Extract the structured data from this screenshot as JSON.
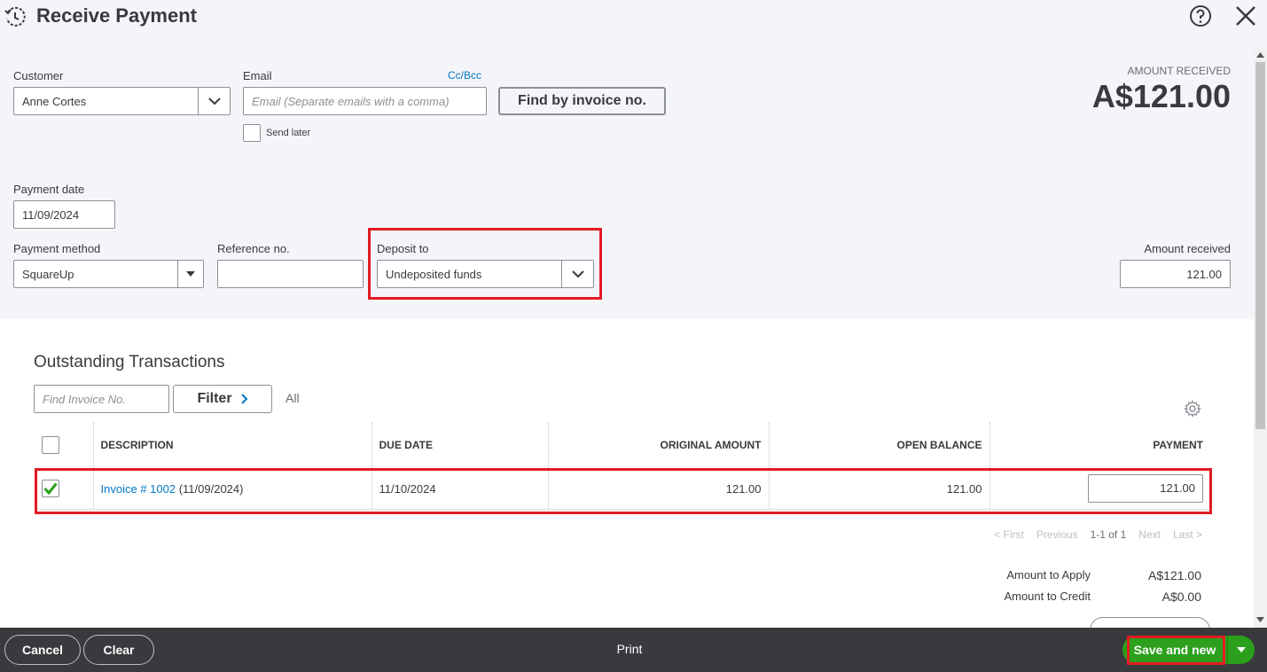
{
  "dialog": {
    "title": "Receive Payment"
  },
  "customer": {
    "label": "Customer",
    "value": "Anne Cortes"
  },
  "email": {
    "label": "Email",
    "placeholder": "Email (Separate emails with a comma)",
    "cc_bcc": "Cc/Bcc",
    "send_later": "Send later"
  },
  "find_by_invoice": "Find by invoice no.",
  "amount_received_header": {
    "label": "AMOUNT RECEIVED",
    "value": "A$121.00"
  },
  "payment_date": {
    "label": "Payment date",
    "value": "11/09/2024"
  },
  "payment_method": {
    "label": "Payment method",
    "value": "SquareUp"
  },
  "reference_no": {
    "label": "Reference no.",
    "value": ""
  },
  "deposit_to": {
    "label": "Deposit to",
    "value": "Undeposited funds"
  },
  "amount_received": {
    "label": "Amount received",
    "value": "121.00"
  },
  "outstanding": {
    "heading": "Outstanding Transactions",
    "search_placeholder": "Find Invoice No.",
    "filter_label": "Filter",
    "filter_state": "All",
    "columns": [
      "DESCRIPTION",
      "DUE DATE",
      "ORIGINAL AMOUNT",
      "OPEN BALANCE",
      "PAYMENT"
    ],
    "rows": [
      {
        "checked": true,
        "invoice_link": "Invoice # 1002",
        "invoice_date": "(11/09/2024)",
        "due_date": "11/10/2024",
        "original_amount": "121.00",
        "open_balance": "121.00",
        "payment": "121.00"
      }
    ],
    "pagination": {
      "first": "< First",
      "previous": "Previous",
      "range": "1-1 of 1",
      "next": "Next",
      "last": "Last >"
    }
  },
  "totals": {
    "apply_label": "Amount to Apply",
    "apply_value": "A$121.00",
    "credit_label": "Amount to Credit",
    "credit_value": "A$0.00"
  },
  "footer": {
    "cancel": "Cancel",
    "clear": "Clear",
    "print": "Print",
    "save_new": "Save and new"
  },
  "colors": {
    "accent_green": "#2ca01c",
    "link_blue": "#0077c5",
    "highlight_red": "#e31b23",
    "footer_bg": "#393a3d"
  },
  "icons": [
    "history-icon",
    "help-icon",
    "close-icon",
    "chevron-down-icon",
    "chevron-right-icon",
    "gear-icon",
    "checkmark-icon",
    "caret-down-icon"
  ]
}
